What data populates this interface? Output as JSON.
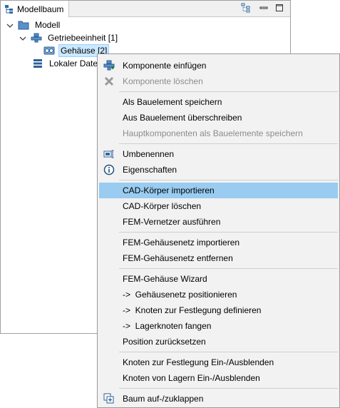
{
  "tree_panel": {
    "tab_title": "Modellbaum",
    "nodes": [
      {
        "label": "Modell",
        "icon": "folder-icon"
      },
      {
        "label": "Getriebeeinheit [1]",
        "icon": "component-icon"
      },
      {
        "label": "Gehäuse [2]",
        "icon": "housing-icon"
      },
      {
        "label": "Lokaler Daten",
        "icon": "database-icon"
      }
    ]
  },
  "context_menu": {
    "items": [
      {
        "label": "Komponente einfügen",
        "icon": "insert-component-icon",
        "enabled": true
      },
      {
        "label": "Komponente löschen",
        "icon": "delete-x-icon",
        "enabled": false
      },
      {
        "label": "Als Bauelement speichern",
        "enabled": true
      },
      {
        "label": "Aus Bauelement überschreiben",
        "enabled": true
      },
      {
        "label": "Hauptkomponenten als Bauelemente speichern",
        "enabled": false
      },
      {
        "label": "Umbenennen",
        "icon": "rename-icon",
        "enabled": true
      },
      {
        "label": "Eigenschaften",
        "icon": "info-icon",
        "enabled": true
      },
      {
        "label": "CAD-Körper importieren",
        "enabled": true,
        "highlighted": true
      },
      {
        "label": "CAD-Körper löschen",
        "enabled": true
      },
      {
        "label": "FEM-Vernetzer ausführen",
        "enabled": true
      },
      {
        "label": "FEM-Gehäusenetz importieren",
        "enabled": true
      },
      {
        "label": "FEM-Gehäusenetz entfernen",
        "enabled": true
      },
      {
        "label": "FEM-Gehäuse Wizard",
        "enabled": true
      },
      {
        "label": "->  Gehäusenetz positionieren",
        "enabled": true
      },
      {
        "label": "->  Knoten zur Festlegung definieren",
        "enabled": true
      },
      {
        "label": "->  Lagerknoten fangen",
        "enabled": true
      },
      {
        "label": "Position zurücksetzen",
        "enabled": true
      },
      {
        "label": "Knoten zur Festlegung Ein-/Ausblenden",
        "enabled": true
      },
      {
        "label": "Knoten von Lagern Ein-/Ausblenden",
        "enabled": true
      },
      {
        "label": "Baum auf-/zuklappen",
        "icon": "expand-tree-icon",
        "enabled": true
      }
    ]
  },
  "colors": {
    "highlight": "#99ccf0",
    "selection": "#cce8ff",
    "menu_bg": "#f2f2f2",
    "disabled_text": "#8c8c8c",
    "icon_blue": "#2e6da4"
  }
}
